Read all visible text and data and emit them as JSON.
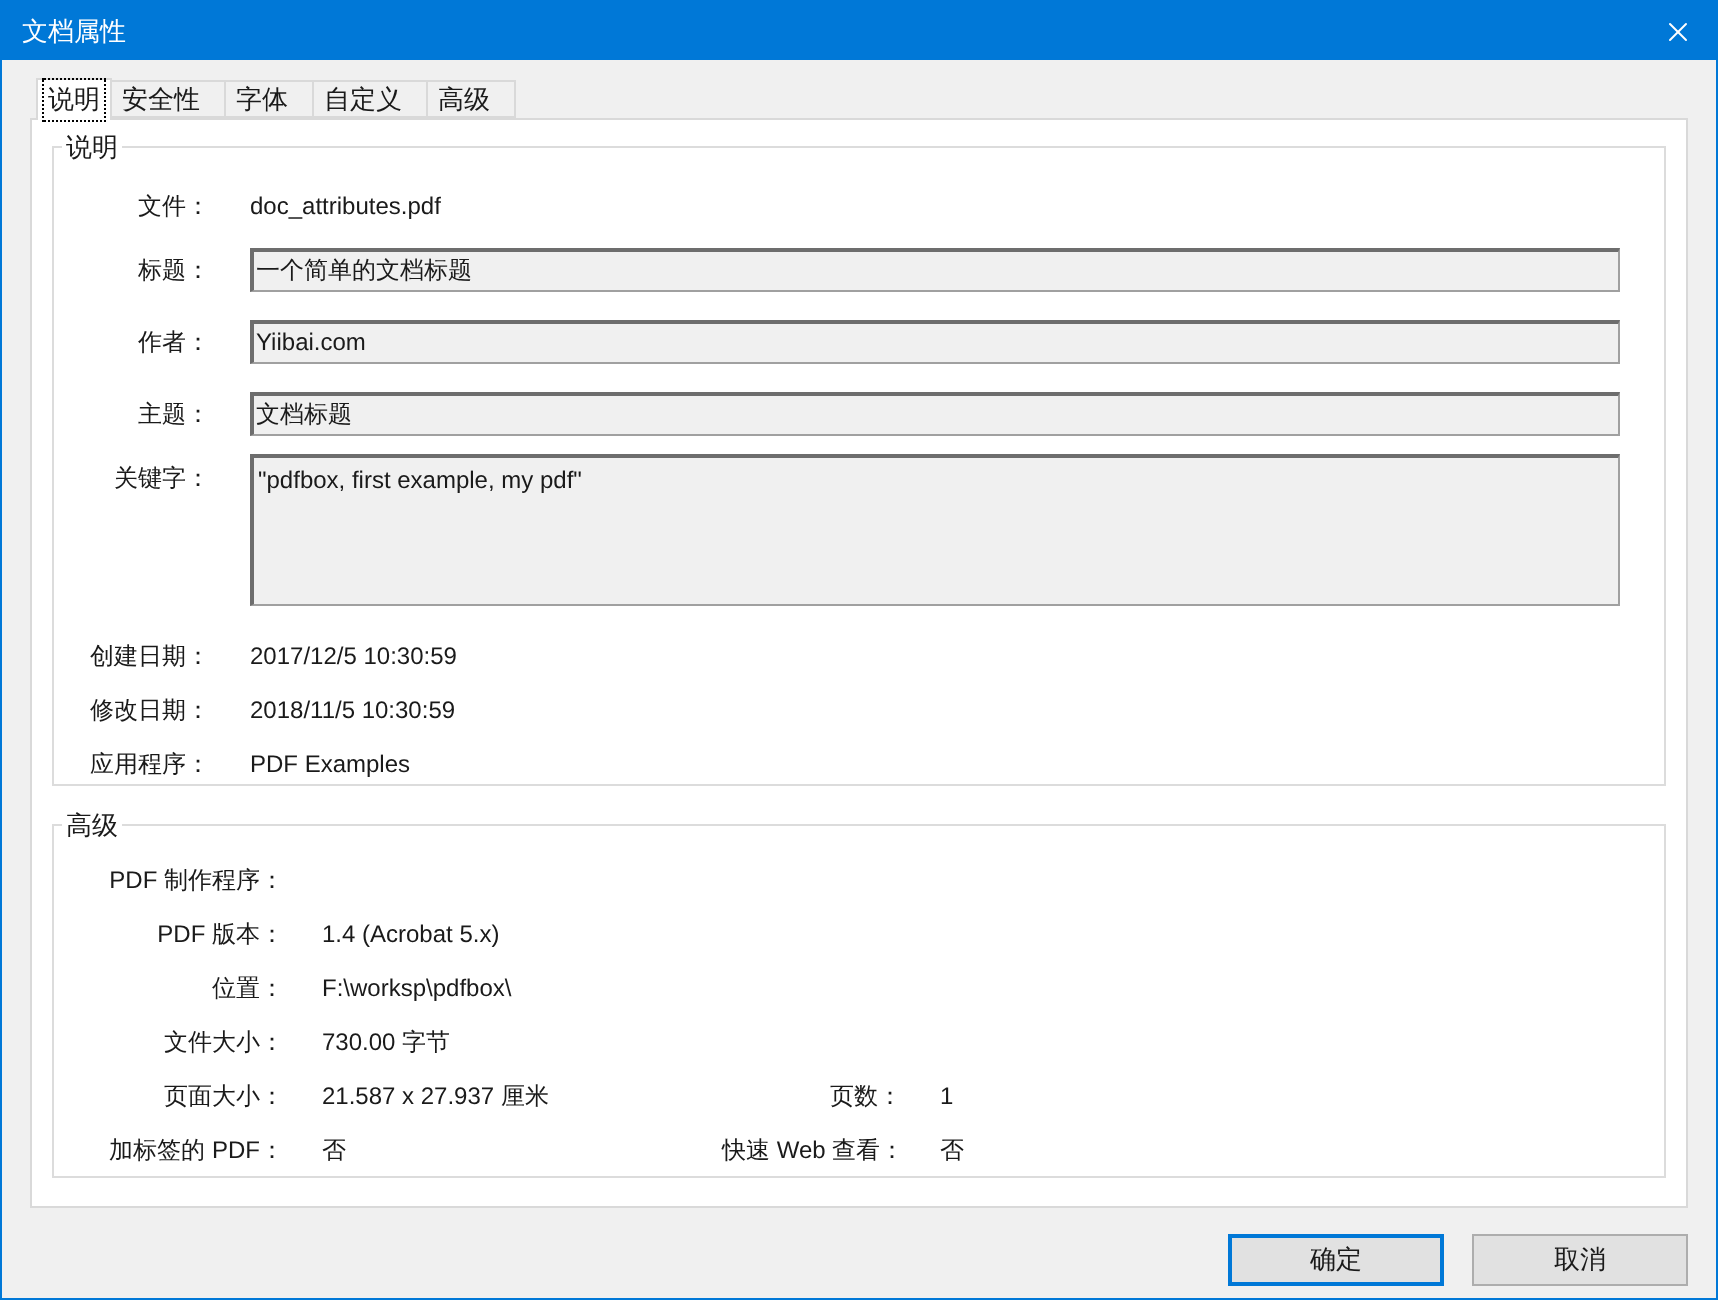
{
  "window": {
    "title": "文档属性"
  },
  "tabs": [
    {
      "label": "说明",
      "selected": true
    },
    {
      "label": "安全性",
      "selected": false
    },
    {
      "label": "字体",
      "selected": false
    },
    {
      "label": "自定义",
      "selected": false
    },
    {
      "label": "高级",
      "selected": false
    }
  ],
  "description": {
    "title": "说明",
    "rows": [
      {
        "kind": "text",
        "label": "文件：",
        "value": "doc_attributes.pdf"
      },
      {
        "kind": "field",
        "label": "标题：",
        "value": "一个简单的文档标题"
      },
      {
        "kind": "field",
        "label": "作者：",
        "value": "Yiibai.com"
      },
      {
        "kind": "field",
        "label": "主题：",
        "value": "文档标题"
      },
      {
        "kind": "multiline",
        "label": "关键字：",
        "value": "\"pdfbox, first example, my pdf\""
      },
      {
        "kind": "text",
        "label": "创建日期：",
        "value": "2017/12/5 10:30:59"
      },
      {
        "kind": "text",
        "label": "修改日期：",
        "value": "2018/11/5 10:30:59"
      },
      {
        "kind": "text",
        "label": "应用程序：",
        "value": "PDF Examples"
      }
    ]
  },
  "advanced": {
    "title": "高级",
    "rows": [
      {
        "label": "PDF 制作程序："
      },
      {
        "label": "PDF 版本：",
        "value": "1.4 (Acrobat 5.x)"
      },
      {
        "label": "位置：",
        "value": "F:\\worksp\\pdfbox\\"
      },
      {
        "label": "文件大小：",
        "value": "730.00 字节"
      },
      {
        "label": "页面大小：",
        "value": "21.587 x 27.937 厘米",
        "extra_label": "页数：",
        "extra_value": "1"
      },
      {
        "label": "加标签的 PDF：",
        "value": "否",
        "extra_label": "快速 Web 查看：",
        "extra_value": "否"
      }
    ]
  },
  "buttons": [
    {
      "label": "确定",
      "default": true
    },
    {
      "label": "取消",
      "default": false
    }
  ]
}
